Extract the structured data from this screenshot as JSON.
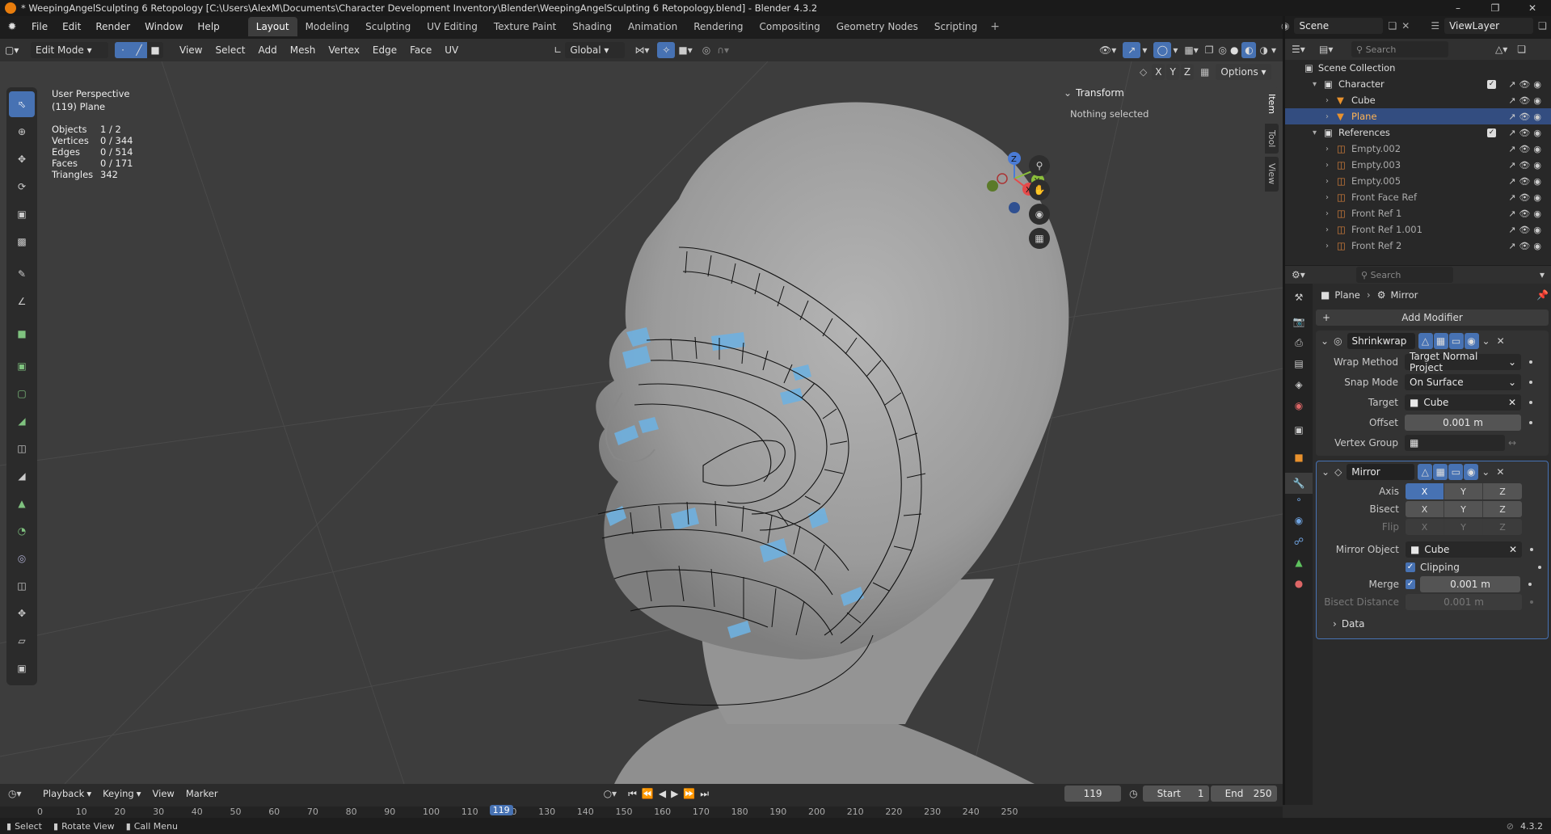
{
  "window": {
    "title": "* WeepingAngelSculpting 6 Retopology [C:\\Users\\AlexM\\Documents\\Character Development Inventory\\Blender\\WeepingAngelSculpting 6 Retopology.blend] - Blender 4.3.2"
  },
  "menu": [
    "File",
    "Edit",
    "Render",
    "Window",
    "Help"
  ],
  "workspaces": [
    "Layout",
    "Modeling",
    "Sculpting",
    "UV Editing",
    "Texture Paint",
    "Shading",
    "Animation",
    "Rendering",
    "Compositing",
    "Geometry Nodes",
    "Scripting"
  ],
  "active_workspace": "Layout",
  "scene": {
    "name": "Scene",
    "view_layer": "ViewLayer"
  },
  "viewport_header": {
    "mode": "Edit Mode",
    "menus": [
      "View",
      "Select",
      "Add",
      "Mesh",
      "Vertex",
      "Edge",
      "Face",
      "UV"
    ],
    "orientation": "Global",
    "axes": [
      "X",
      "Y",
      "Z"
    ],
    "options": "Options"
  },
  "overlay": {
    "perspective": "User Perspective",
    "object": "(119) Plane",
    "stats": [
      {
        "label": "Objects",
        "value": "1 / 2"
      },
      {
        "label": "Vertices",
        "value": "0 / 344"
      },
      {
        "label": "Edges",
        "value": "0 / 514"
      },
      {
        "label": "Faces",
        "value": "0 / 171"
      },
      {
        "label": "Triangles",
        "value": "342"
      }
    ]
  },
  "sidebar_panel": {
    "transform_title": "Transform",
    "transform_text": "Nothing selected",
    "tabs": [
      "Item",
      "Tool",
      "View"
    ]
  },
  "outliner": {
    "search_placeholder": "Search",
    "root": "Scene Collection",
    "items": [
      {
        "name": "Character",
        "depth": 1,
        "kind": "collection"
      },
      {
        "name": "Cube",
        "depth": 2,
        "kind": "mesh"
      },
      {
        "name": "Plane",
        "depth": 2,
        "kind": "mesh",
        "selected": true
      },
      {
        "name": "References",
        "depth": 1,
        "kind": "collection"
      },
      {
        "name": "Empty.002",
        "depth": 2,
        "kind": "empty"
      },
      {
        "name": "Empty.003",
        "depth": 2,
        "kind": "empty"
      },
      {
        "name": "Empty.005",
        "depth": 2,
        "kind": "empty"
      },
      {
        "name": "Front Face Ref",
        "depth": 2,
        "kind": "empty"
      },
      {
        "name": "Front Ref 1",
        "depth": 2,
        "kind": "empty"
      },
      {
        "name": "Front Ref 1.001",
        "depth": 2,
        "kind": "empty"
      },
      {
        "name": "Front Ref 2",
        "depth": 2,
        "kind": "empty"
      }
    ]
  },
  "properties": {
    "search_placeholder": "Search",
    "breadcrumb_object": "Plane",
    "breadcrumb_modifier": "Mirror",
    "add_modifier": "Add Modifier",
    "shrinkwrap": {
      "name": "Shrinkwrap",
      "wrap_method_label": "Wrap Method",
      "wrap_method": "Target Normal Project",
      "snap_mode_label": "Snap Mode",
      "snap_mode": "On Surface",
      "target_label": "Target",
      "target": "Cube",
      "offset_label": "Offset",
      "offset": "0.001 m",
      "vertex_group_label": "Vertex Group",
      "vertex_group": ""
    },
    "mirror": {
      "name": "Mirror",
      "axis_label": "Axis",
      "bisect_label": "Bisect",
      "flip_label": "Flip",
      "mirror_object_label": "Mirror Object",
      "mirror_object": "Cube",
      "clipping_label": "Clipping",
      "clipping": true,
      "merge_label": "Merge",
      "merge": true,
      "merge_value": "0.001 m",
      "bisect_distance_label": "Bisect Distance",
      "bisect_distance": "0.001 m",
      "data_label": "Data",
      "axis_on": [
        "X"
      ]
    }
  },
  "timeline": {
    "menus": [
      "Playback",
      "Keying",
      "View",
      "Marker"
    ],
    "current_frame": "119",
    "start_label": "Start",
    "start": "1",
    "end_label": "End",
    "end": "250",
    "ticks": [
      "0",
      "10",
      "20",
      "30",
      "40",
      "50",
      "60",
      "70",
      "80",
      "90",
      "100",
      "110",
      "120",
      "130",
      "140",
      "150",
      "160",
      "170",
      "180",
      "190",
      "200",
      "210",
      "220",
      "230",
      "240",
      "250"
    ]
  },
  "statusbar": {
    "select": "Select",
    "rotate": "Rotate View",
    "menu": "Call Menu",
    "version": "4.3.2"
  },
  "colors": {
    "accent": "#4772b3",
    "viewport_bg": "#3d3d3d",
    "mesh": "#9a9a9a",
    "face_selected_overlay": "#6fb1e0"
  }
}
